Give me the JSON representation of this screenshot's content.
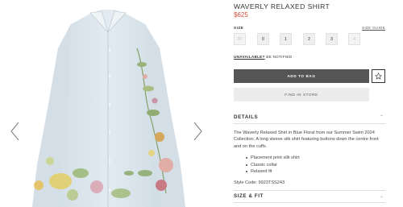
{
  "product": {
    "title": "WAVERLY RELAXED SHIRT",
    "price": "$625",
    "size_label": "SIZE",
    "size_guide": "SIZE GUIDE",
    "sizes": [
      {
        "label": "0P",
        "available": false
      },
      {
        "label": "0",
        "available": true
      },
      {
        "label": "1",
        "available": true
      },
      {
        "label": "2",
        "available": true
      },
      {
        "label": "3",
        "available": true
      },
      {
        "label": "4",
        "available": false
      }
    ],
    "notify_link": "UNAVAILABLE?",
    "notify_text": "BE NOTIFIED",
    "add_to_bag": "ADD TO BAG",
    "find_in_store": "FIND IN STORE",
    "wishlist_icon": "star-icon"
  },
  "details": {
    "heading": "DETAILS",
    "description": "The Waverly Relaxed Shirt in Blue Floral from our Summer Swim 2024 Collection. A long sleeve silk shirt featuring buttons down the centre front and on the cuffs.",
    "bullets": [
      "Placement print silk shirt",
      "Classic collar",
      "Relaxed fit"
    ],
    "style_code": "Style Code: 9923TSS243"
  },
  "size_fit": {
    "heading": "SIZE & FIT"
  },
  "gallery": {
    "prev_icon": "chevron-left-icon",
    "next_icon": "chevron-right-icon"
  },
  "colors": {
    "price": "#d24a3a",
    "primary_button": "#555555",
    "shirt_base": "#dbe6ee"
  }
}
